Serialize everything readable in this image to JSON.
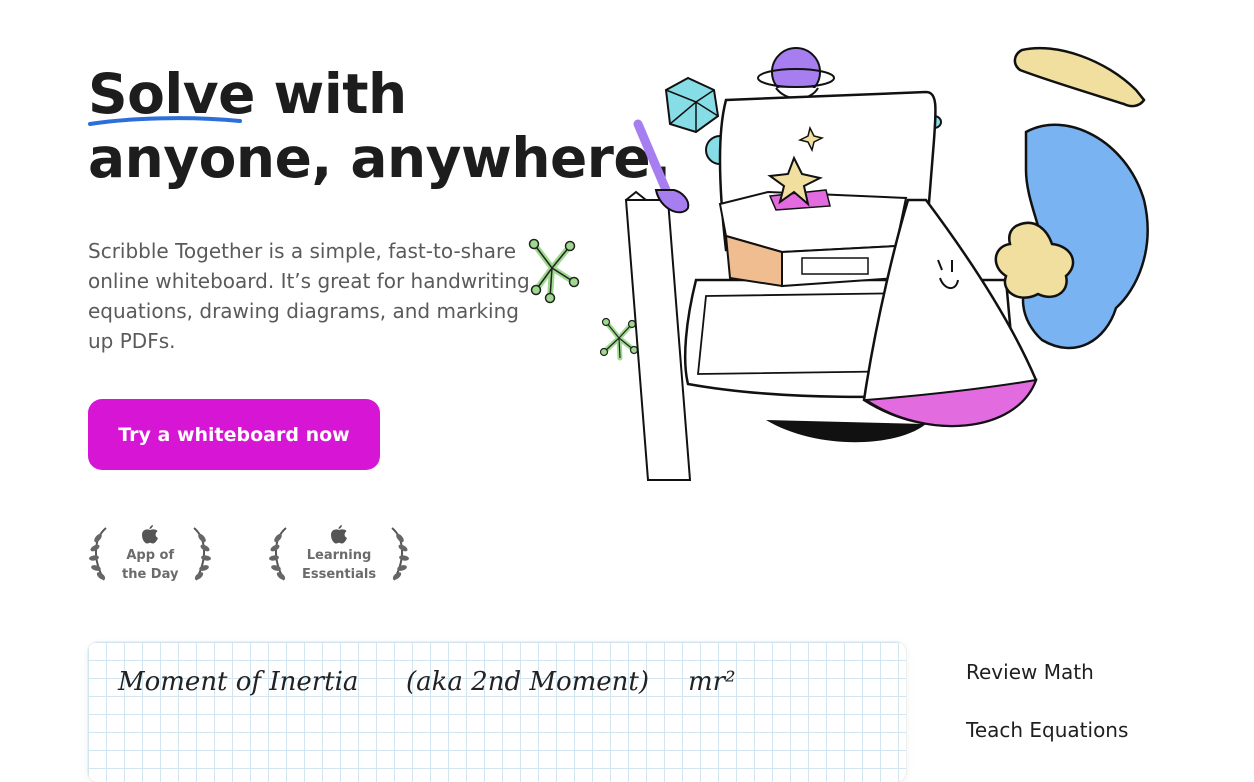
{
  "hero": {
    "title_underlined": "Solve",
    "title_rest": " with",
    "title_line2": "anyone, anywhere.",
    "description": "Scribble Together is a simple, fast-to-share online whiteboard. It’s great for handwriting equations, drawing diagrams, and marking up PDFs.",
    "cta_label": "Try a whiteboard now"
  },
  "awards": [
    {
      "icon": "apple-icon",
      "line1": "App of",
      "line2": "the Day"
    },
    {
      "icon": "apple-icon",
      "line1": "Learning",
      "line2": "Essentials"
    }
  ],
  "whiteboard_preview": {
    "handwriting": [
      "Moment of Inertia",
      "(aka 2nd Moment)",
      "mr²"
    ]
  },
  "side_nav": [
    "Review Math",
    "Teach Equations"
  ],
  "colors": {
    "accent": "#d616d4",
    "underline_blue": "#2b6fd8",
    "doodle_purple": "#a67ef0",
    "doodle_blue": "#7ab3f1",
    "doodle_yellow": "#f1dfa0",
    "doodle_pink": "#e26be0",
    "doodle_cyan": "#86dde6",
    "doodle_orange": "#f0bd90",
    "doodle_green": "#9ed98f"
  }
}
